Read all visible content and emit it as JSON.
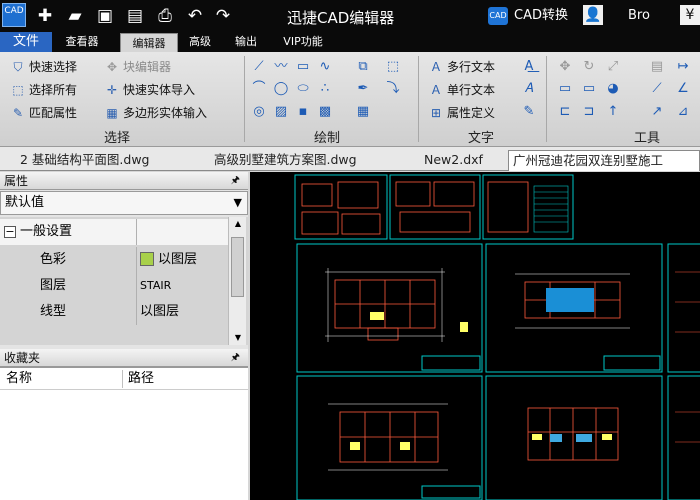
{
  "app": {
    "title": "迅捷CAD编辑器",
    "logo_text": "CAD",
    "cad_convert_label": "CAD转换",
    "cad_convert_icon_text": "CAD",
    "user_name": "Bro"
  },
  "quick_access": [
    "new-icon",
    "open-icon",
    "save-icon",
    "save-as-icon",
    "print-icon",
    "undo-icon",
    "redo-icon"
  ],
  "tabs": [
    {
      "label": "文件"
    },
    {
      "label": "查看器"
    },
    {
      "label": "编辑器"
    },
    {
      "label": "高级"
    },
    {
      "label": "输出"
    },
    {
      "label": "VIP功能"
    }
  ],
  "ribbon": {
    "select_group": {
      "label": "选择",
      "quick_select": "快速选择",
      "select_all": "选择所有",
      "match_props": "匹配属性",
      "block_editor": "块编辑器",
      "quick_solid_import": "快速实体导入",
      "polygon_solid_input": "多边形实体输入"
    },
    "draw_group": {
      "label": "绘制"
    },
    "text_group": {
      "label": "文字",
      "mtext": "多行文本",
      "stext": "单行文本",
      "attdef": "属性定义"
    },
    "tools_group": {
      "label": "工具"
    }
  },
  "doc_tabs": [
    {
      "label": "2 基础结构平面图.dwg"
    },
    {
      "label": "高级别墅建筑方案图.dwg"
    },
    {
      "label": "New2.dxf"
    },
    {
      "label": "广州冠迪花园双连别墅施工"
    }
  ],
  "properties_panel": {
    "title": "属性",
    "dropdown_value": "默认值",
    "section": "一般设置",
    "rows": [
      {
        "key": "色彩",
        "value": "以图层"
      },
      {
        "key": "图层",
        "value": "STAIR"
      },
      {
        "key": "线型",
        "value": "以图层"
      }
    ],
    "layer_color": "#a8d04a"
  },
  "favorites_panel": {
    "title": "收藏夹",
    "col_name": "名称",
    "col_path": "路径"
  },
  "colors": {
    "frame": "#00c8c8",
    "plan_lines": "#ff5a3c",
    "accent_blue": "#2a66c2"
  }
}
